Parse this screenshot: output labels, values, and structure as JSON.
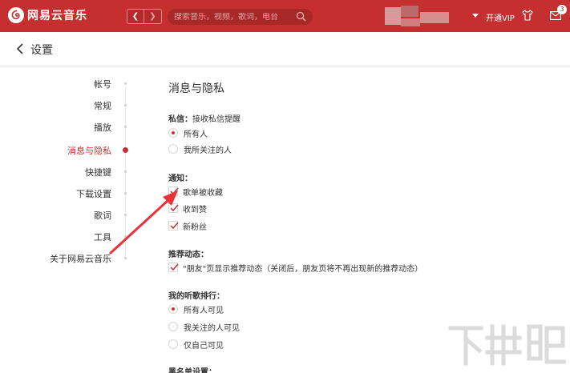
{
  "topbar": {
    "brand": "网易云音乐",
    "search_placeholder": "搜索音乐，视频，歌词，电台",
    "vip_label": "开通VIP",
    "message_count": "3"
  },
  "header": {
    "title": "设置"
  },
  "sidebar": {
    "items": [
      {
        "label": "帐号"
      },
      {
        "label": "常规"
      },
      {
        "label": "播放"
      },
      {
        "label": "消息与隐私",
        "active": true
      },
      {
        "label": "快捷键"
      },
      {
        "label": "下载设置"
      },
      {
        "label": "歌词"
      },
      {
        "label": "工具"
      },
      {
        "label": "关于网易云音乐"
      }
    ]
  },
  "content": {
    "section_title": "消息与隐私",
    "private_message": {
      "label": "私信：",
      "sub": "接收私信提醒",
      "options": [
        {
          "label": "所有人",
          "selected": true
        },
        {
          "label": "我所关注的人",
          "selected": false
        }
      ]
    },
    "notifications": {
      "label": "通知：",
      "options": [
        {
          "label": "歌单被收藏",
          "checked": true
        },
        {
          "label": "收到赞",
          "checked": true
        },
        {
          "label": "新粉丝",
          "checked": true
        }
      ]
    },
    "recommend": {
      "label": "推荐动态：",
      "option": {
        "label": "\"朋友\"页显示推荐动态（关闭后，朋友页将不再出现新的推荐动态）",
        "checked": true
      }
    },
    "ranking": {
      "label": "我的听歌排行：",
      "options": [
        {
          "label": "所有人可见",
          "selected": true
        },
        {
          "label": "我关注的人可见",
          "selected": false
        },
        {
          "label": "仅自己可见",
          "selected": false
        }
      ]
    },
    "blacklist": {
      "label": "黑名单设置："
    }
  },
  "watermark": {
    "text": "下载吧"
  },
  "colors": {
    "brand_red": "#c62f2f",
    "annotation_red": "#e8333a"
  }
}
